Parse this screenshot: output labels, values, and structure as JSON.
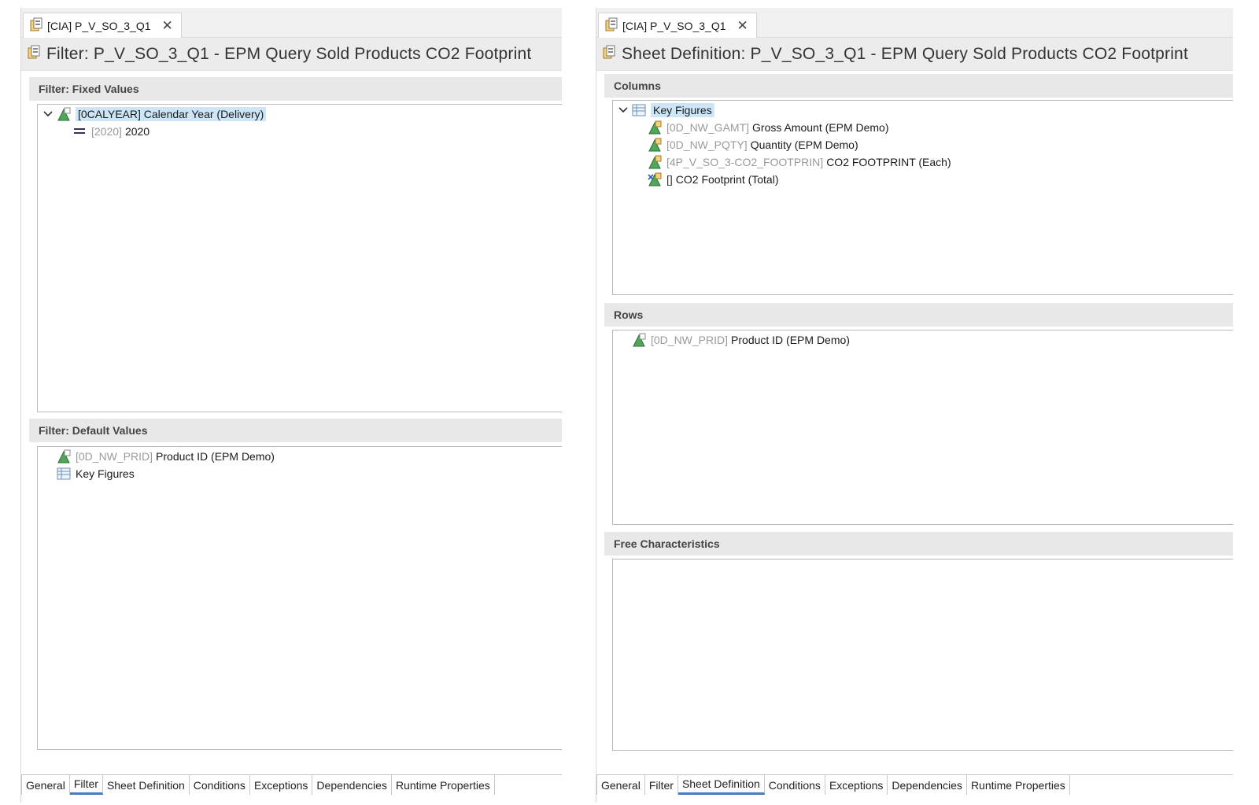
{
  "left": {
    "tab_label": "[CIA] P_V_SO_3_Q1",
    "title": "Filter: P_V_SO_3_Q1 - EPM Query Sold Products CO2 Footprint",
    "fixed_header": "Filter: Fixed Values",
    "fixed_items": [
      {
        "tech": "",
        "label": "[0CALYEAR] Calendar Year (Delivery)"
      },
      {
        "tech": "[2020]",
        "label": "2020"
      }
    ],
    "default_header": "Filter: Default Values",
    "default_items": [
      {
        "tech": "[0D_NW_PRID]",
        "label": "Product ID (EPM Demo)"
      },
      {
        "tech": "",
        "label": "Key Figures"
      }
    ],
    "bottom_tabs": [
      "General",
      "Filter",
      "Sheet Definition",
      "Conditions",
      "Exceptions",
      "Dependencies",
      "Runtime Properties"
    ],
    "active_tab": "Filter"
  },
  "right": {
    "tab_label": "[CIA] P_V_SO_3_Q1",
    "title": "Sheet Definition: P_V_SO_3_Q1 - EPM Query Sold Products CO2 Footprint",
    "columns_header": "Columns",
    "columns_root": "Key Figures",
    "columns_items": [
      {
        "tech": "[0D_NW_GAMT]",
        "label": "Gross Amount (EPM Demo)"
      },
      {
        "tech": "[0D_NW_PQTY]",
        "label": "Quantity (EPM Demo)"
      },
      {
        "tech": "[4P_V_SO_3-CO2_FOOTPRIN]",
        "label": "CO2 FOOTPRINT (Each)"
      },
      {
        "tech": "[]",
        "label": "CO2 Footprint (Total)"
      }
    ],
    "rows_header": "Rows",
    "rows_items": [
      {
        "tech": "[0D_NW_PRID]",
        "label": "Product ID (EPM Demo)"
      }
    ],
    "free_header": "Free Characteristics",
    "bottom_tabs": [
      "General",
      "Filter",
      "Sheet Definition",
      "Conditions",
      "Exceptions",
      "Dependencies",
      "Runtime Properties"
    ],
    "active_tab": "Sheet Definition"
  },
  "icons": {
    "query": "query-icon",
    "characteristic": "characteristic-icon",
    "key_figure": "key-figure-icon",
    "formula": "formula-key-figure-icon",
    "structure": "structure-icon",
    "value": "fixed-value-icon"
  },
  "colors": {
    "selection": "#cde6f7",
    "active_tab_underline": "#3d7fc1",
    "tech_name": "#9a9a9a"
  }
}
